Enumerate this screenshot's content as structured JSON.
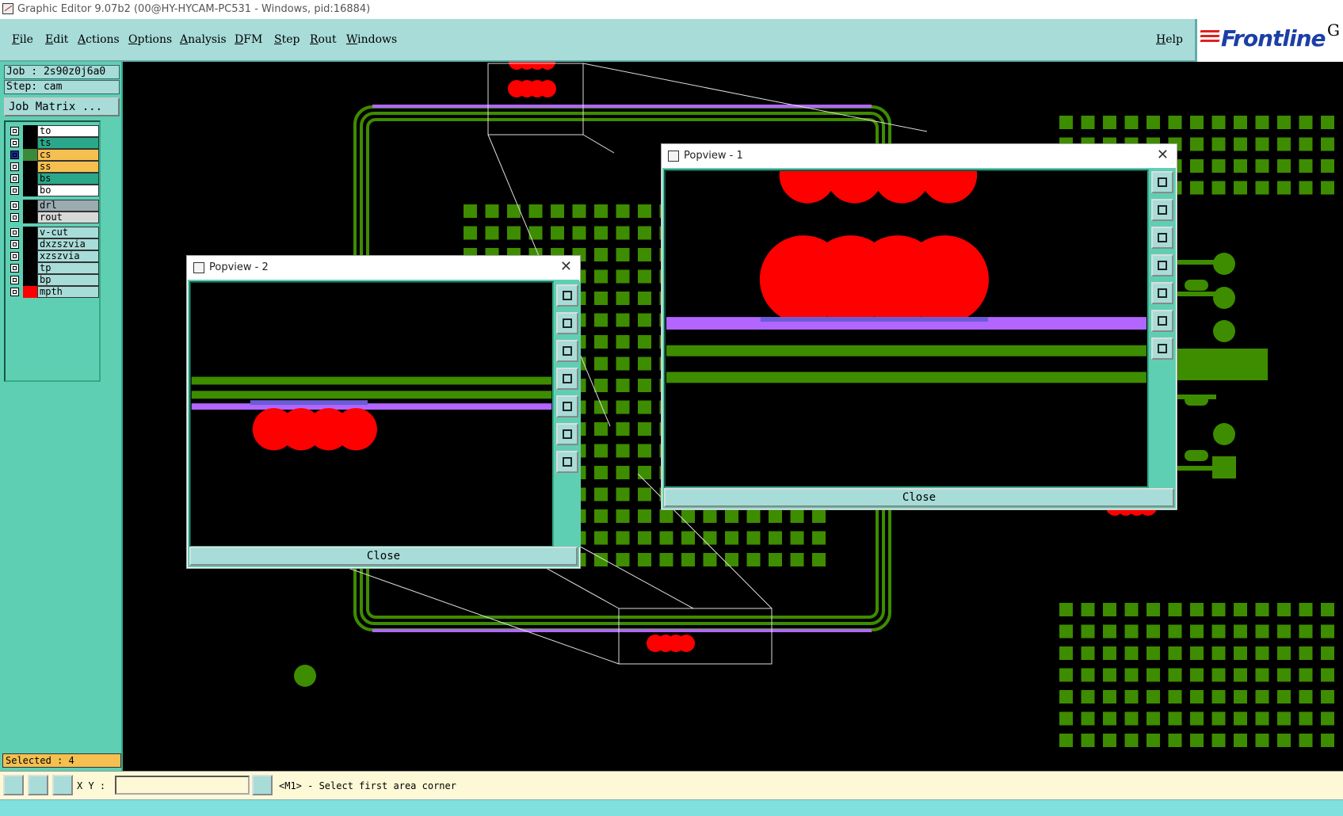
{
  "window": {
    "title": "Graphic Editor 9.07b2 (00@HY-HYCAM-PC531 - Windows, pid:16884)"
  },
  "menu": {
    "items": [
      "File",
      "Edit",
      "Actions",
      "Options",
      "Analysis",
      "DFM",
      "Step",
      "Rout",
      "Windows"
    ],
    "help": "Help"
  },
  "logo": {
    "text": "Frontline",
    "suffix": "G"
  },
  "job": {
    "job_label": "Job : 2s90z0j6a0",
    "step_label": "Step: cam",
    "matrix_button": "Job Matrix ..."
  },
  "layers": [
    {
      "name": "to",
      "color": "#ffffff"
    },
    {
      "name": "ts",
      "color": "#2aa88a"
    },
    {
      "name": "cs",
      "color": "#f5c050",
      "active": true
    },
    {
      "name": "ss",
      "color": "#f5c050"
    },
    {
      "name": "bs",
      "color": "#2aa88a"
    },
    {
      "name": "bo",
      "color": "#ffffff"
    },
    {
      "name": "drl",
      "color": "#9aacb0"
    },
    {
      "name": "rout",
      "color": "#d8d8d8"
    },
    {
      "name": "v-cut",
      "color": "#a8dcd8"
    },
    {
      "name": "dxzszvia",
      "color": "#a8dcd8"
    },
    {
      "name": "xzszvia",
      "color": "#a8dcd8"
    },
    {
      "name": "tp",
      "color": "#a8dcd8"
    },
    {
      "name": "bp",
      "color": "#a8dcd8"
    },
    {
      "name": "mpth",
      "color": "#a8dcd8",
      "swatch": "#ff0000"
    }
  ],
  "status": {
    "selected": "Selected : 4",
    "xy_label": "X Y :",
    "xy_value": "",
    "prompt": "<M1> - Select first area corner"
  },
  "popview1": {
    "title": "Popview - 1",
    "close_label": "Close"
  },
  "popview2": {
    "title": "Popview - 2",
    "close_label": "Close"
  },
  "colors": {
    "copper": "#3e8c00",
    "pad": "#ff0000",
    "outline": "#b266ff",
    "panel": "#5fcfb4",
    "menu": "#a8dcd8"
  }
}
